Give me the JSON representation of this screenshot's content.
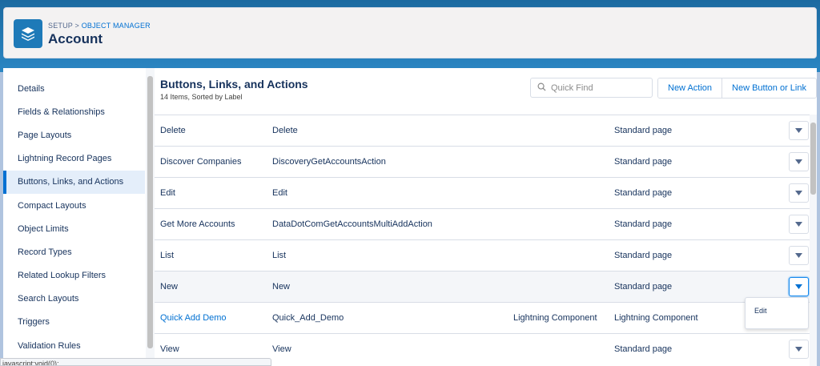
{
  "header": {
    "breadcrumb_setup": "SETUP",
    "breadcrumb_sep": " > ",
    "breadcrumb_object_manager": "OBJECT MANAGER",
    "title": "Account",
    "icon": "layers-icon"
  },
  "sidebar": {
    "items": [
      {
        "label": "Details",
        "active": false
      },
      {
        "label": "Fields & Relationships",
        "active": false
      },
      {
        "label": "Page Layouts",
        "active": false
      },
      {
        "label": "Lightning Record Pages",
        "active": false
      },
      {
        "label": "Buttons, Links, and Actions",
        "active": true
      },
      {
        "label": "Compact Layouts",
        "active": false
      },
      {
        "label": "Object Limits",
        "active": false
      },
      {
        "label": "Record Types",
        "active": false
      },
      {
        "label": "Related Lookup Filters",
        "active": false
      },
      {
        "label": "Search Layouts",
        "active": false
      },
      {
        "label": "Triggers",
        "active": false
      },
      {
        "label": "Validation Rules",
        "active": false
      }
    ]
  },
  "main": {
    "title": "Buttons, Links, and Actions",
    "subtitle": "14 Items, Sorted by Label",
    "search_placeholder": "Quick Find",
    "new_action_label": "New Action",
    "new_button_label": "New Button or Link",
    "rows": [
      {
        "label": "Delete",
        "name": "Delete",
        "override": "",
        "content": "Standard page",
        "link": false
      },
      {
        "label": "Discover Companies",
        "name": "DiscoveryGetAccountsAction",
        "override": "",
        "content": "Standard page",
        "link": false
      },
      {
        "label": "Edit",
        "name": "Edit",
        "override": "",
        "content": "Standard page",
        "link": false
      },
      {
        "label": "Get More Accounts",
        "name": "DataDotComGetAccountsMultiAddAction",
        "override": "",
        "content": "Standard page",
        "link": false
      },
      {
        "label": "List",
        "name": "List",
        "override": "",
        "content": "Standard page",
        "link": false
      },
      {
        "label": "New",
        "name": "New",
        "override": "",
        "content": "Standard page",
        "link": false
      },
      {
        "label": "Quick Add Demo",
        "name": "Quick_Add_Demo",
        "override": "Lightning Component",
        "content": "Lightning Component",
        "link": true
      },
      {
        "label": "View",
        "name": "View",
        "override": "",
        "content": "Standard page",
        "link": false
      }
    ],
    "dropdown_item": "Edit"
  },
  "status_bar": {
    "text": "javascript:void(0);"
  },
  "colors": {
    "accent": "#0070d2",
    "active_bg": "#e4eefa",
    "header_bg": "#1b6aa0"
  }
}
